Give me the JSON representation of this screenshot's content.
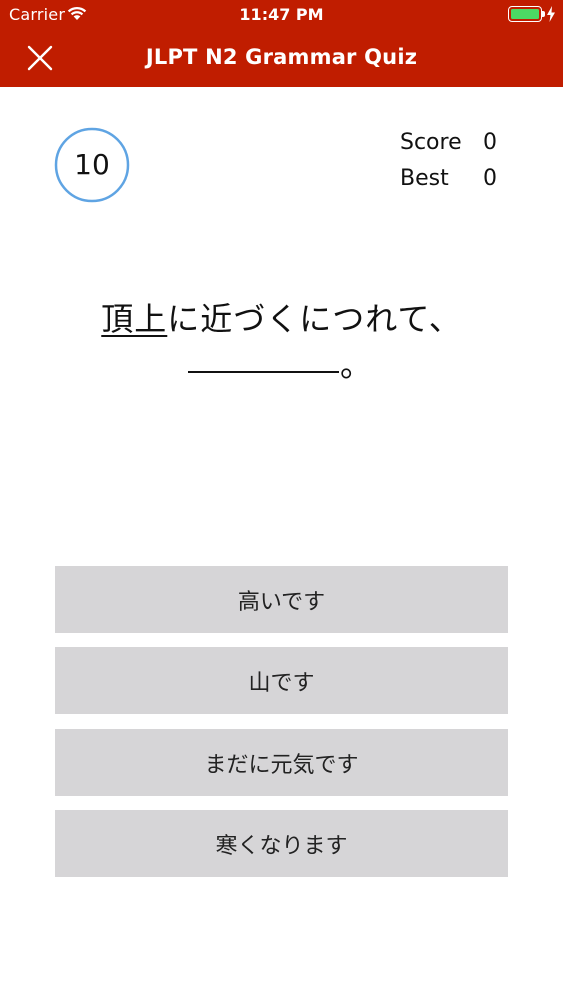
{
  "status_bar": {
    "carrier": "Carrier",
    "time": "11:47 PM",
    "battery_level": 1.0
  },
  "header": {
    "title": "JLPT N2 Grammar Quiz",
    "close_icon": "close-icon",
    "background_color": "#c01d00"
  },
  "timer": {
    "value": "10",
    "ring_color": "#5fa4e3"
  },
  "score": {
    "score_label": "Score",
    "score_value": "0",
    "best_label": "Best",
    "best_value": "0"
  },
  "question": {
    "underlined": "頂上",
    "rest": "に近づくにつれて、",
    "end": "。"
  },
  "answers": [
    "高いです",
    "山です",
    "まだに元気です",
    "寒くなります"
  ],
  "colors": {
    "answer_bg": "#d6d5d7",
    "battery_green": "#4cd964"
  }
}
